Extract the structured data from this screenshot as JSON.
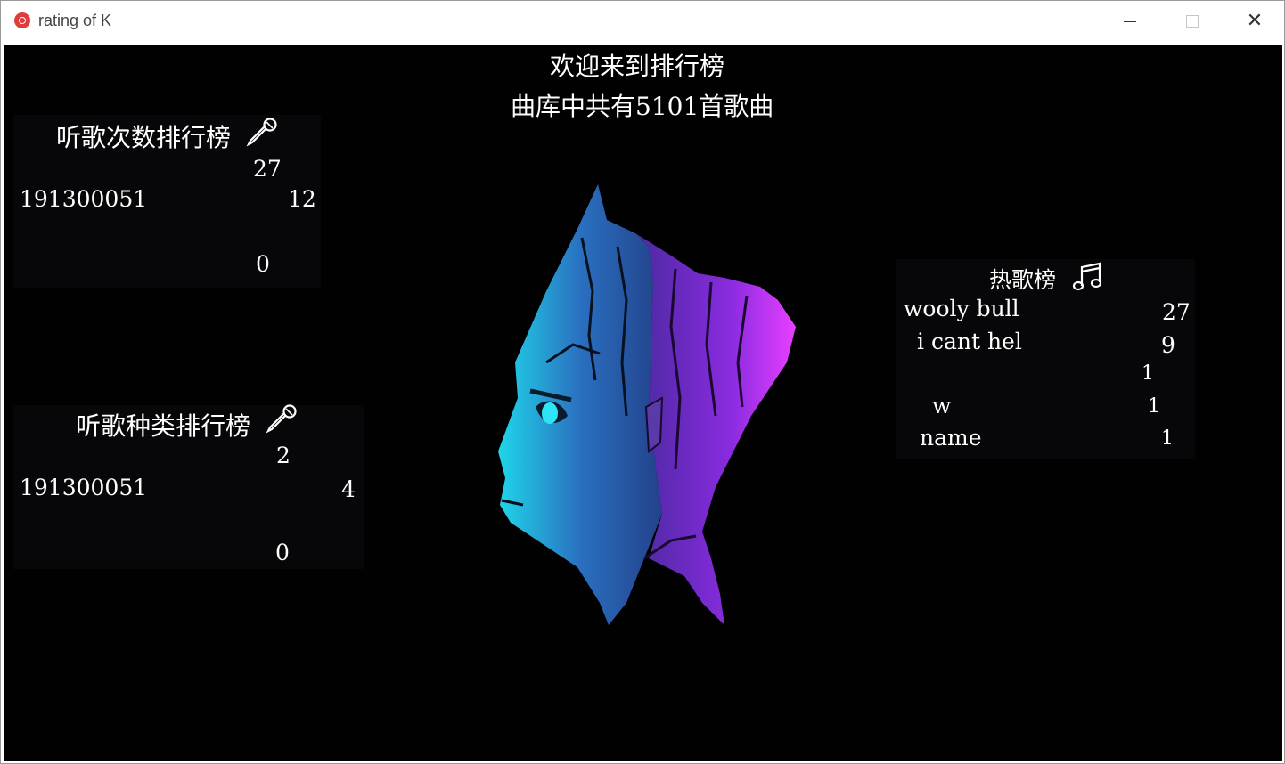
{
  "window": {
    "title": "rating of K",
    "controls": [
      "minimize",
      "maximize",
      "close"
    ]
  },
  "header": {
    "welcome": "欢迎来到排行榜",
    "library_count": "曲库中共有5101首歌曲"
  },
  "listen_count_board": {
    "title": "听歌次数排行榜",
    "icon": "microphone-icon",
    "rows": [
      {
        "name": "",
        "value": "27"
      },
      {
        "name": "191300051",
        "value": "12"
      },
      {
        "name": "",
        "value": "0"
      }
    ]
  },
  "listen_type_board": {
    "title": "听歌种类排行榜",
    "icon": "microphone-icon",
    "rows": [
      {
        "name": "",
        "value": "2"
      },
      {
        "name": "191300051",
        "value": "4"
      },
      {
        "name": "",
        "value": "0"
      }
    ]
  },
  "hot_songs_board": {
    "title": "热歌榜",
    "icon": "music-note-icon",
    "rows": [
      {
        "name": "wooly bull",
        "value": "27"
      },
      {
        "name": "i cant hel",
        "value": "9"
      },
      {
        "name": "",
        "value": "1"
      },
      {
        "name": "w",
        "value": "1"
      },
      {
        "name": "name",
        "value": "1"
      }
    ]
  },
  "colors": {
    "background": "#010102",
    "groot_cyan": "#1fd0e8",
    "groot_blue": "#2a5aa8",
    "groot_purple": "#8a2be0",
    "groot_magenta": "#e040ff"
  }
}
